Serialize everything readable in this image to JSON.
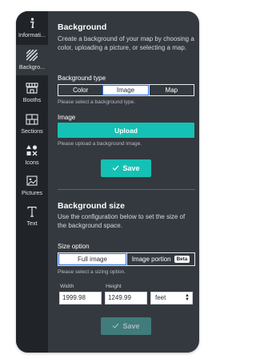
{
  "sidebar": {
    "items": [
      {
        "label": "Informati...",
        "icon": "info-icon"
      },
      {
        "label": "Backgro...",
        "icon": "hatch-pattern-icon"
      },
      {
        "label": "Booths",
        "icon": "booths-icon"
      },
      {
        "label": "Sections",
        "icon": "sections-icon"
      },
      {
        "label": "Icons",
        "icon": "shapes-icon"
      },
      {
        "label": "Pictures",
        "icon": "picture-icon"
      },
      {
        "label": "Text",
        "icon": "text-icon"
      }
    ]
  },
  "background": {
    "title": "Background",
    "description": "Create a background of your map by choosing a color, uploading a picture, or selecting a map.",
    "type_label": "Background type",
    "type_options": [
      "Color",
      "Image",
      "Map"
    ],
    "type_selected": "Image",
    "type_help": "Please select a background type.",
    "image_label": "Image",
    "upload_label": "Upload",
    "upload_help": "Please upload a background image.",
    "save_label": "Save"
  },
  "size": {
    "title": "Background size",
    "description": "Use the configuration below to set the size of the background space.",
    "option_label": "Size option",
    "options": [
      "Full image",
      "Image portion"
    ],
    "option_selected": "Full image",
    "beta_badge": "Beta",
    "option_help": "Please select a sizing option.",
    "width_label": "Width",
    "width_value": "1999.98",
    "height_label": "Height",
    "height_value": "1249.99",
    "unit_value": "feet",
    "save_label": "Save"
  },
  "colors": {
    "accent": "#15c1b4",
    "panel_bg": "#34393f",
    "sidebar_bg": "#202428",
    "selected_border": "#2d6fe0"
  }
}
